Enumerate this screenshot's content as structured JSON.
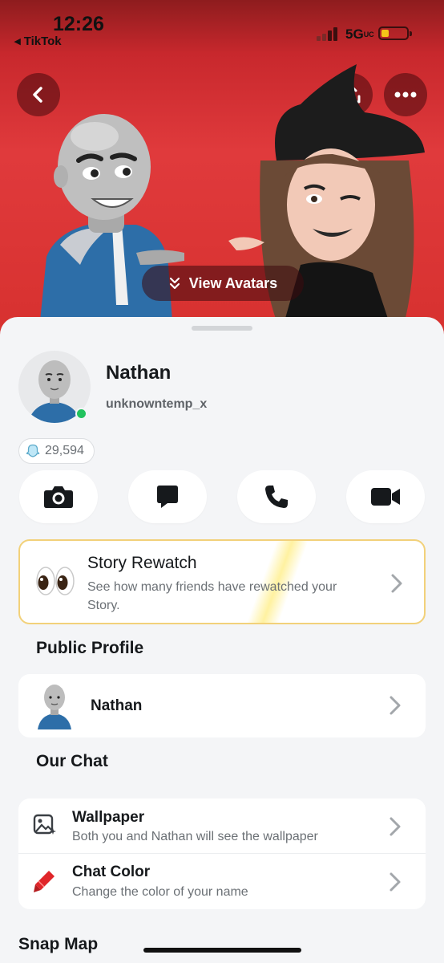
{
  "status_bar": {
    "time": "12:26",
    "back_app": "◂ TikTok",
    "network": "5G",
    "network_suffix": "UC"
  },
  "hero": {
    "view_avatars_label": "View Avatars",
    "icons": [
      "chevron-left-icon",
      "share-icon",
      "more-icon"
    ],
    "background_color": "#d7312f"
  },
  "profile": {
    "display_name": "Nathan",
    "username": "unknowntemp_x",
    "snap_score": "29,594",
    "online_color": "#21c25e"
  },
  "actions": [
    {
      "name": "camera",
      "icon": "camera-icon"
    },
    {
      "name": "chat",
      "icon": "chat-icon"
    },
    {
      "name": "call",
      "icon": "phone-icon"
    },
    {
      "name": "video",
      "icon": "video-icon"
    }
  ],
  "story_rewatch": {
    "title": "Story Rewatch",
    "subtitle": "See how many friends have rewatched your Story.",
    "icon": "eyes-icon",
    "border_color": "#f2d17a"
  },
  "public_profile": {
    "heading": "Public Profile",
    "name": "Nathan"
  },
  "our_chat": {
    "heading": "Our Chat",
    "items": [
      {
        "title": "Wallpaper",
        "subtitle": "Both you and Nathan will see the wallpaper",
        "icon": "wallpaper-icon"
      },
      {
        "title": "Chat Color",
        "subtitle": "Change the color of your name",
        "icon": "crayon-icon"
      }
    ]
  },
  "snap_map": {
    "heading": "Snap Map"
  }
}
